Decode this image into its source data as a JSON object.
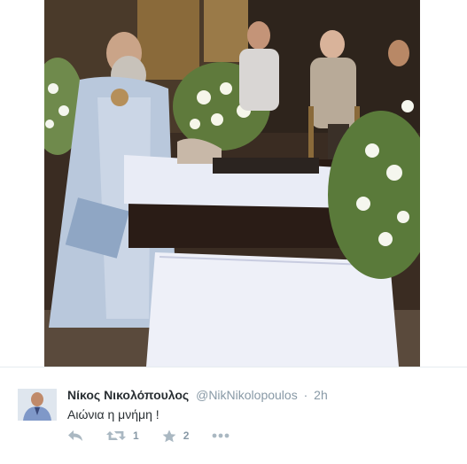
{
  "photo": {
    "description_icon": "photo-icon"
  },
  "tweet": {
    "author_name": "Νίκος Νικολόπουλος",
    "handle": "@NikNikolopoulos",
    "separator": "·",
    "time": "2h",
    "text": "Αιώνια η μνήμη !",
    "actions": {
      "reply_icon": "reply-icon",
      "retweet_icon": "retweet-icon",
      "retweet_count": "1",
      "favorite_icon": "star-icon",
      "favorite_count": "2",
      "more_icon": "more-icon"
    }
  },
  "colors": {
    "name": "#292f33",
    "muted": "#8899a6",
    "icon": "#aab8c2"
  }
}
